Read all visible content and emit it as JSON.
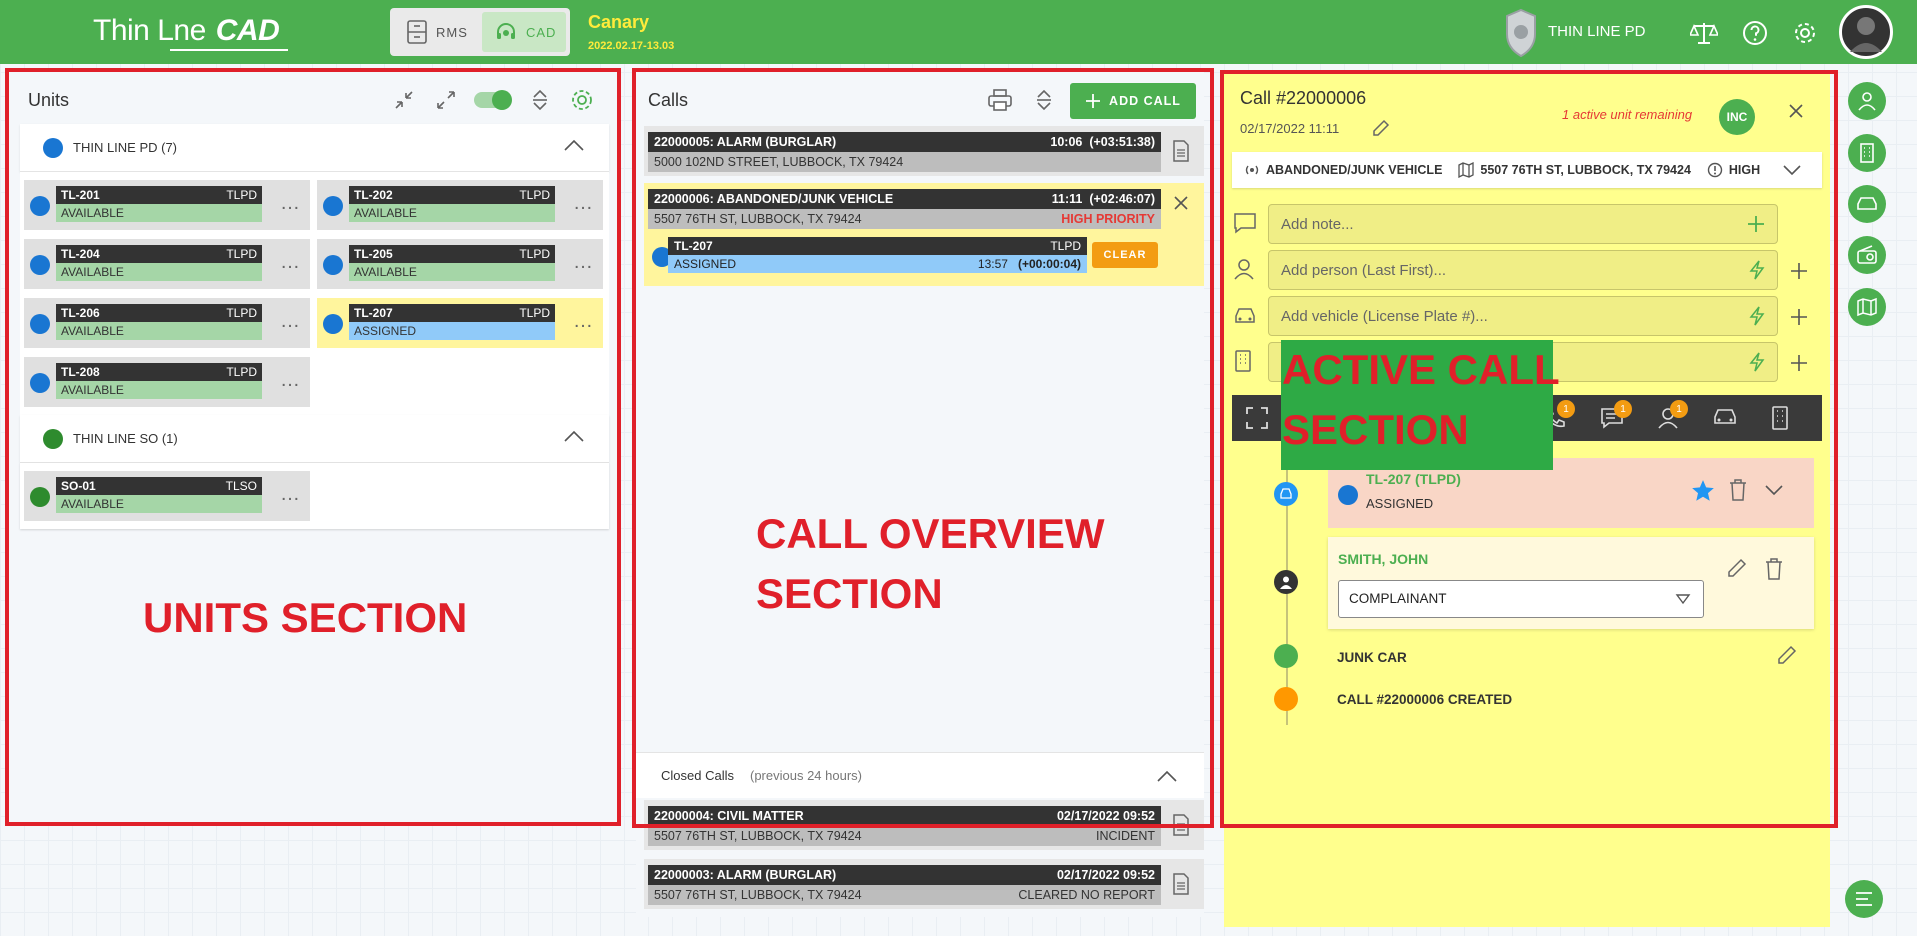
{
  "app": {
    "logo_left": "Thin L",
    "logo_mid": "ne",
    "logo_cad": "CAD",
    "env": "Canary",
    "version": "2022.02.17-13.03",
    "agency": "THIN LINE PD",
    "brand_color": "#4caf50"
  },
  "modes": {
    "rms": "RMS",
    "cad": "CAD"
  },
  "units": {
    "title": "Units",
    "group1": {
      "name": "THIN LINE PD (7)",
      "color": "#1976d2"
    },
    "group2": {
      "name": "THIN LINE SO (1)",
      "color": "#2e8b2e"
    },
    "cards": [
      {
        "id": "TL-201",
        "agency": "TLPD",
        "status": "AVAILABLE"
      },
      {
        "id": "TL-202",
        "agency": "TLPD",
        "status": "AVAILABLE"
      },
      {
        "id": "TL-204",
        "agency": "TLPD",
        "status": "AVAILABLE"
      },
      {
        "id": "TL-205",
        "agency": "TLPD",
        "status": "AVAILABLE"
      },
      {
        "id": "TL-206",
        "agency": "TLPD",
        "status": "AVAILABLE"
      },
      {
        "id": "TL-207",
        "agency": "TLPD",
        "status": "ASSIGNED"
      },
      {
        "id": "TL-208",
        "agency": "TLPD",
        "status": "AVAILABLE"
      },
      {
        "id": "SO-01",
        "agency": "TLSO",
        "status": "AVAILABLE"
      }
    ],
    "more": "…"
  },
  "calls": {
    "title": "Calls",
    "add_label": "ADD CALL",
    "open": [
      {
        "title": "22000005: ALARM (BURGLAR)",
        "time": "10:06",
        "elapsed": "(+03:51:38)",
        "address": "5000 102ND STREET, LUBBOCK, TX 79424",
        "right": ""
      },
      {
        "title": "22000006: ABANDONED/JUNK VEHICLE",
        "time": "11:11",
        "elapsed": "(+02:46:07)",
        "address": "5507 76TH ST, LUBBOCK, TX 79424",
        "right": "HIGH PRIORITY"
      }
    ],
    "assigned_unit": {
      "id": "TL-207",
      "agency": "TLPD",
      "status": "ASSIGNED",
      "time": "13:57",
      "elapsed": "(+00:00:04)",
      "clear": "CLEAR"
    },
    "closed_title": "Closed Calls",
    "closed_sub": "(previous 24 hours)",
    "closed": [
      {
        "title": "22000004: CIVIL MATTER",
        "time": "02/17/2022 09:52",
        "address": "5507 76TH ST, LUBBOCK, TX 79424",
        "right": "INCIDENT"
      },
      {
        "title": "22000003: ALARM (BURGLAR)",
        "time": "02/17/2022 09:52",
        "address": "5507 76TH ST, LUBBOCK, TX 79424",
        "right": "CLEARED NO REPORT"
      }
    ]
  },
  "active": {
    "title": "Call #22000006",
    "date": "02/17/2022 11:11",
    "remaining": "1 active unit remaining",
    "inc": "INC",
    "type": "ABANDONED/JUNK VEHICLE",
    "address": "5507 76TH ST, LUBBOCK, TX 79424",
    "priority": "HIGH",
    "note_ph": "Add note...",
    "person_ph": "Add person (Last First)...",
    "vehicle_ph": "Add vehicle (License Plate #)...",
    "badges": {
      "b1": "1",
      "b2": "1",
      "b3": "1"
    },
    "timeline": {
      "unit": "TL-207 (TLPD)",
      "unit_status": "ASSIGNED",
      "person": "SMITH, JOHN",
      "role": "COMPLAINANT",
      "note": "JUNK CAR",
      "created": "CALL #22000006 CREATED"
    }
  },
  "overlay": {
    "units": "UNITS SECTION",
    "calls1": "CALL OVERVIEW",
    "calls2": "SECTION",
    "active1": "ACTIVE CALL",
    "active2": "SECTION"
  },
  "colors": {
    "available": "#a5d6a7",
    "assigned": "#90caf9",
    "highlight": "#fff59d",
    "active_bg": "#ffff8d",
    "annotation": "#e0202a",
    "clear": "#f39c12"
  }
}
